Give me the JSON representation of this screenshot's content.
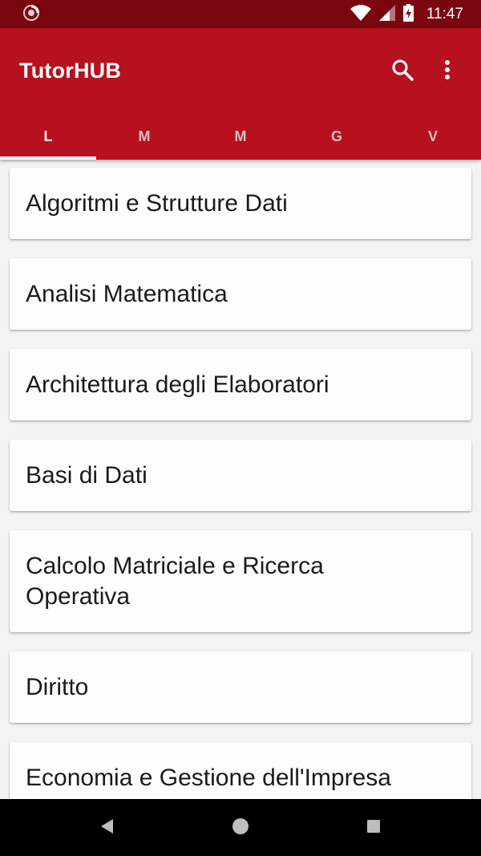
{
  "status_bar": {
    "time": "11:47",
    "icons": [
      "app-notification-icon",
      "wifi-icon",
      "signal-icon",
      "battery-charging-icon"
    ]
  },
  "app_bar": {
    "title": "TutorHUB",
    "actions": [
      "search-icon",
      "more-vert-icon"
    ]
  },
  "tabs": [
    {
      "label": "L",
      "active": true
    },
    {
      "label": "M",
      "active": false
    },
    {
      "label": "M",
      "active": false
    },
    {
      "label": "G",
      "active": false
    },
    {
      "label": "V",
      "active": false
    }
  ],
  "courses": [
    "Algoritmi e Strutture Dati",
    "Analisi Matematica",
    "Architettura degli Elaboratori",
    "Basi di Dati",
    "Calcolo Matriciale e Ricerca Operativa",
    "Diritto",
    "Economia e Gestione dell'Impresa"
  ],
  "nav_bar": [
    "back-icon",
    "home-icon",
    "recents-icon"
  ],
  "colors": {
    "status_bar": "#7a0710",
    "app_bar": "#b7101e",
    "background": "#f3f2f5",
    "card": "#fdfcfe"
  }
}
